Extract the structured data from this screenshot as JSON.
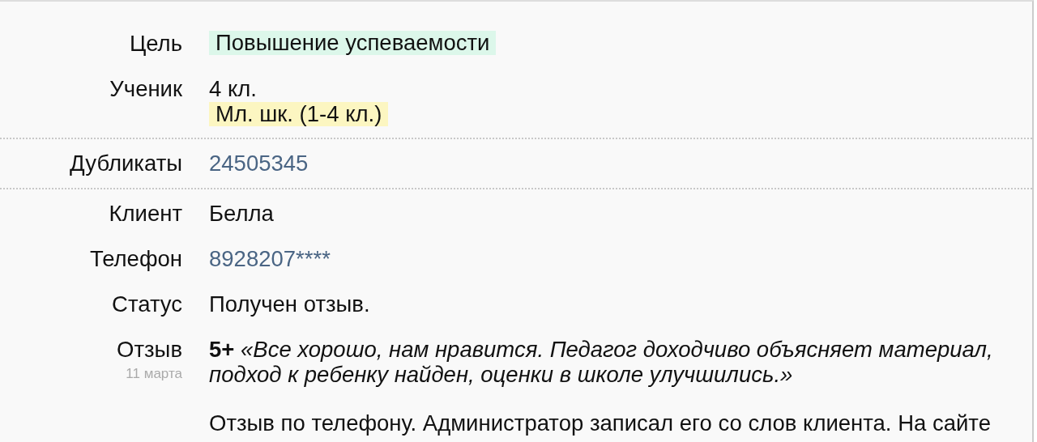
{
  "sections": [
    {
      "rows": [
        {
          "label": "Цель",
          "parts": [
            {
              "kind": "tag",
              "text": "Повышение успеваемости",
              "color": "#dcf7ea"
            }
          ]
        },
        {
          "label": "Ученик",
          "parts": [
            {
              "kind": "text",
              "text": "4 кл."
            },
            {
              "kind": "tag",
              "text": "Мл. шк. (1-4 кл.)",
              "color": "#fcf6c1"
            }
          ]
        }
      ]
    },
    {
      "rows": [
        {
          "label": "Дубликаты",
          "parts": [
            {
              "kind": "link",
              "text": "24505345"
            }
          ]
        }
      ]
    },
    {
      "rows": [
        {
          "label": "Клиент",
          "parts": [
            {
              "kind": "text",
              "text": "Белла"
            }
          ]
        },
        {
          "label": "Телефон",
          "parts": [
            {
              "kind": "link",
              "text": "8928207****"
            }
          ]
        },
        {
          "label": "Статус",
          "parts": [
            {
              "kind": "text",
              "text": "Получен отзыв."
            }
          ]
        },
        {
          "label": "Отзыв",
          "date": "11 марта",
          "parts": [
            {
              "kind": "review",
              "text": "**5+** *«Все хорошо, нам нравится. Педагог доходчиво объясняет материал, подход к ребенку найден, оценки в школе улучшились.»*"
            },
            {
              "kind": "note",
              "text": "Отзыв по телефону. Администратор записал его со слов клиента. На сайте"
            }
          ]
        }
      ]
    }
  ]
}
